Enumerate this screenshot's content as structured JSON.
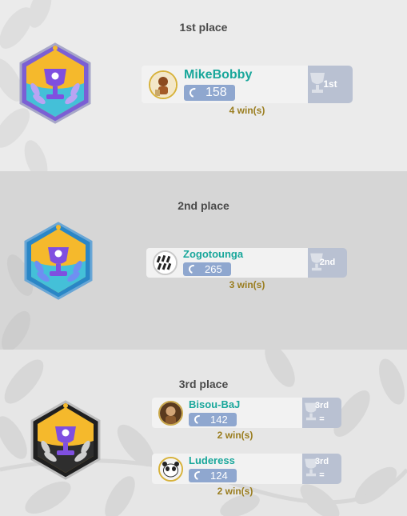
{
  "places": [
    {
      "title": "1st place",
      "badge": "trophy-badge-purple",
      "players": [
        {
          "name": "MikeBobby",
          "elo": "158",
          "rank": "1st",
          "wins": "4 win(s)"
        }
      ]
    },
    {
      "title": "2nd place",
      "badge": "trophy-badge-blue",
      "players": [
        {
          "name": "Zogotounga",
          "elo": "265",
          "rank": "2nd",
          "wins": "3 win(s)"
        }
      ]
    },
    {
      "title": "3rd place",
      "badge": "trophy-badge-black",
      "players": [
        {
          "name": "Bisou-BaJ",
          "elo": "142",
          "rank": "3rd",
          "tie": "=",
          "wins": "2 win(s)"
        },
        {
          "name": "Luderess",
          "elo": "124",
          "rank": "3rd",
          "tie": "=",
          "wins": "2 win(s)"
        }
      ]
    }
  ],
  "colors": {
    "player_name": "#19a79b",
    "elo_badge": "#8fa7cf",
    "rank_side": "#b9c1d2",
    "wins_text": "#9a7d1f"
  }
}
